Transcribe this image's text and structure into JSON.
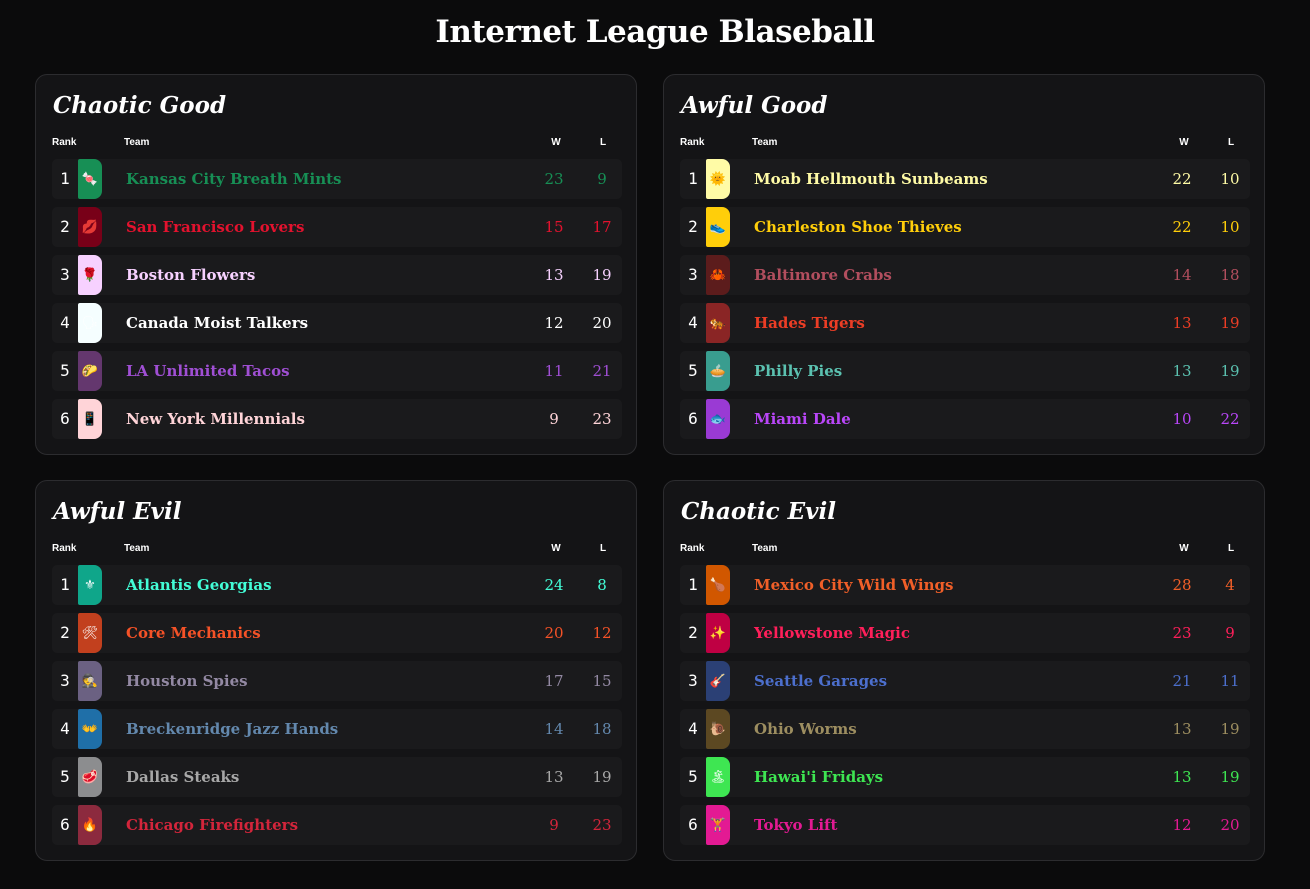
{
  "title": "Internet League Blaseball",
  "headers": {
    "rank": "Rank",
    "team": "Team",
    "w": "W",
    "l": "L"
  },
  "divisions": [
    {
      "name": "Chaotic Good",
      "teams": [
        {
          "rank": "1",
          "name": "Kansas City Breath Mints",
          "w": "23",
          "l": "9",
          "color": "#178f55",
          "emoji_bg": "#178f55",
          "emoji": "🍬"
        },
        {
          "rank": "2",
          "name": "San Francisco Lovers",
          "w": "15",
          "l": "17",
          "color": "#e3122e",
          "emoji_bg": "#780018",
          "emoji": "💋"
        },
        {
          "rank": "3",
          "name": "Boston Flowers",
          "w": "13",
          "l": "19",
          "color": "#f7d1ff",
          "emoji_bg": "#f7d1ff",
          "emoji": "🌹"
        },
        {
          "rank": "4",
          "name": "Canada Moist Talkers",
          "w": "12",
          "l": "20",
          "color": "#ffffff",
          "emoji_bg": "#f5feff",
          "emoji": "🗣"
        },
        {
          "rank": "5",
          "name": "LA Unlimited Tacos",
          "w": "11",
          "l": "21",
          "color": "#a04fd4",
          "emoji_bg": "#64376e",
          "emoji": "🌮"
        },
        {
          "rank": "6",
          "name": "New York Millennials",
          "w": "9",
          "l": "23",
          "color": "#ffd4d8",
          "emoji_bg": "#ffd4d8",
          "emoji": "📱"
        }
      ]
    },
    {
      "name": "Awful Good",
      "teams": [
        {
          "rank": "1",
          "name": "Moab Hellmouth Sunbeams",
          "w": "22",
          "l": "10",
          "color": "#fffba6",
          "emoji_bg": "#fffba6",
          "emoji": "🌞"
        },
        {
          "rank": "2",
          "name": "Charleston Shoe Thieves",
          "w": "22",
          "l": "10",
          "color": "#ffce0a",
          "emoji_bg": "#ffce0a",
          "emoji": "👟"
        },
        {
          "rank": "3",
          "name": "Baltimore Crabs",
          "w": "14",
          "l": "18",
          "color": "#b24e5e",
          "emoji_bg": "#5c1c1c",
          "emoji": "🦀"
        },
        {
          "rank": "4",
          "name": "Hades Tigers",
          "w": "13",
          "l": "19",
          "color": "#ec3d25",
          "emoji_bg": "#8a2525",
          "emoji": "🐅"
        },
        {
          "rank": "5",
          "name": "Philly Pies",
          "w": "13",
          "l": "19",
          "color": "#5bc1b0",
          "emoji_bg": "#399d8f",
          "emoji": "🥧"
        },
        {
          "rank": "6",
          "name": "Miami Dale",
          "w": "10",
          "l": "22",
          "color": "#b946f8",
          "emoji_bg": "#9a3ad4",
          "emoji": "🐟"
        }
      ]
    },
    {
      "name": "Awful Evil",
      "teams": [
        {
          "rank": "1",
          "name": "Atlantis Georgias",
          "w": "24",
          "l": "8",
          "color": "#43fdd7",
          "emoji_bg": "#0fa68a",
          "emoji": "⚜"
        },
        {
          "rank": "2",
          "name": "Core Mechanics",
          "w": "20",
          "l": "12",
          "color": "#f55227",
          "emoji_bg": "#c2401e",
          "emoji": "🛠"
        },
        {
          "rank": "3",
          "name": "Houston Spies",
          "w": "17",
          "l": "15",
          "color": "#9389a3",
          "emoji_bg": "#6b6182",
          "emoji": "🕵"
        },
        {
          "rank": "4",
          "name": "Breckenridge Jazz Hands",
          "w": "14",
          "l": "18",
          "color": "#6388ad",
          "emoji_bg": "#1f6fa8",
          "emoji": "👐"
        },
        {
          "rank": "5",
          "name": "Dallas Steaks",
          "w": "13",
          "l": "19",
          "color": "#a8a8a8",
          "emoji_bg": "#8c8d8f",
          "emoji": "🥩"
        },
        {
          "rank": "6",
          "name": "Chicago Firefighters",
          "w": "9",
          "l": "23",
          "color": "#d3253b",
          "emoji_bg": "#8c2a3e",
          "emoji": "🔥"
        }
      ]
    },
    {
      "name": "Chaotic Evil",
      "teams": [
        {
          "rank": "1",
          "name": "Mexico City Wild Wings",
          "w": "28",
          "l": "4",
          "color": "#f15f28",
          "emoji_bg": "#d15700",
          "emoji": "🍗"
        },
        {
          "rank": "2",
          "name": "Yellowstone Magic",
          "w": "23",
          "l": "9",
          "color": "#ff1f5a",
          "emoji_bg": "#bf0043",
          "emoji": "✨"
        },
        {
          "rank": "3",
          "name": "Seattle Garages",
          "w": "21",
          "l": "11",
          "color": "#4c6fcd",
          "emoji_bg": "#2b4075",
          "emoji": "🎸"
        },
        {
          "rank": "4",
          "name": "Ohio Worms",
          "w": "13",
          "l": "19",
          "color": "#9d8e60",
          "emoji_bg": "#5c4822",
          "emoji": "🐌"
        },
        {
          "rank": "5",
          "name": "Hawai'i Fridays",
          "w": "13",
          "l": "19",
          "color": "#3ee652",
          "emoji_bg": "#3ee652",
          "emoji": "🏝"
        },
        {
          "rank": "6",
          "name": "Tokyo Lift",
          "w": "12",
          "l": "20",
          "color": "#e31a93",
          "emoji_bg": "#e31a93",
          "emoji": "🏋"
        }
      ]
    }
  ]
}
